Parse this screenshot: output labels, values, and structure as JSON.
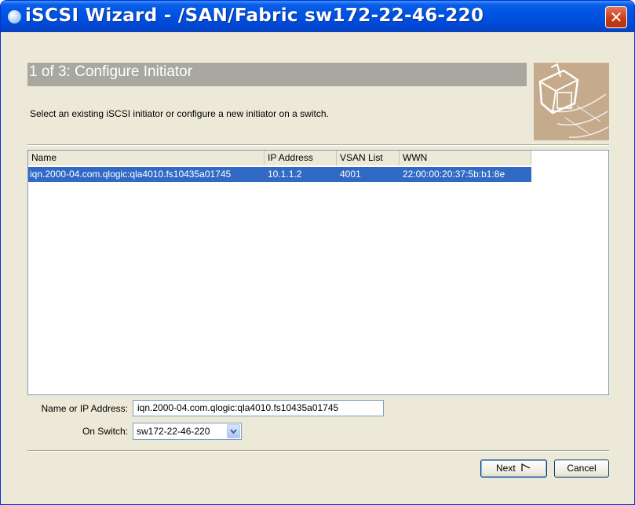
{
  "window": {
    "title": "iSCSI Wizard - /SAN/Fabric sw172-22-46-220",
    "close_glyph": "✕"
  },
  "header": {
    "step_title": "1 of 3: Configure Initiator"
  },
  "subtitle": "Select an existing iSCSI initiator or configure a new initiator on a switch.",
  "table": {
    "columns": [
      "Name",
      "IP Address",
      "VSAN List",
      "WWN"
    ],
    "rows": [
      {
        "name": "iqn.2000-04.com.qlogic:qla4010.fs10435a01745",
        "ip": "10.1.1.2",
        "vsan": "4001",
        "wwn": "22:00:00:20:37:5b:b1:8e",
        "selected": true
      }
    ]
  },
  "form": {
    "name_label": "Name or IP Address:",
    "name_value": "iqn.2000-04.com.qlogic:qla4010.fs10435a01745",
    "switch_label": "On Switch:",
    "switch_value": "sw172-22-46-220"
  },
  "buttons": {
    "next": "Next",
    "cancel": "Cancel"
  },
  "colors": {
    "title_bar": "#0054e3",
    "selection": "#316ac5",
    "header_bar": "#a8a8a0",
    "dialog_bg": "#ece9d8"
  },
  "icons": {
    "title": "globe-icon",
    "close": "close-icon",
    "dropdown": "chevron-down-icon",
    "next": "next-arrow-icon",
    "art": "wizard-computer-icon"
  }
}
